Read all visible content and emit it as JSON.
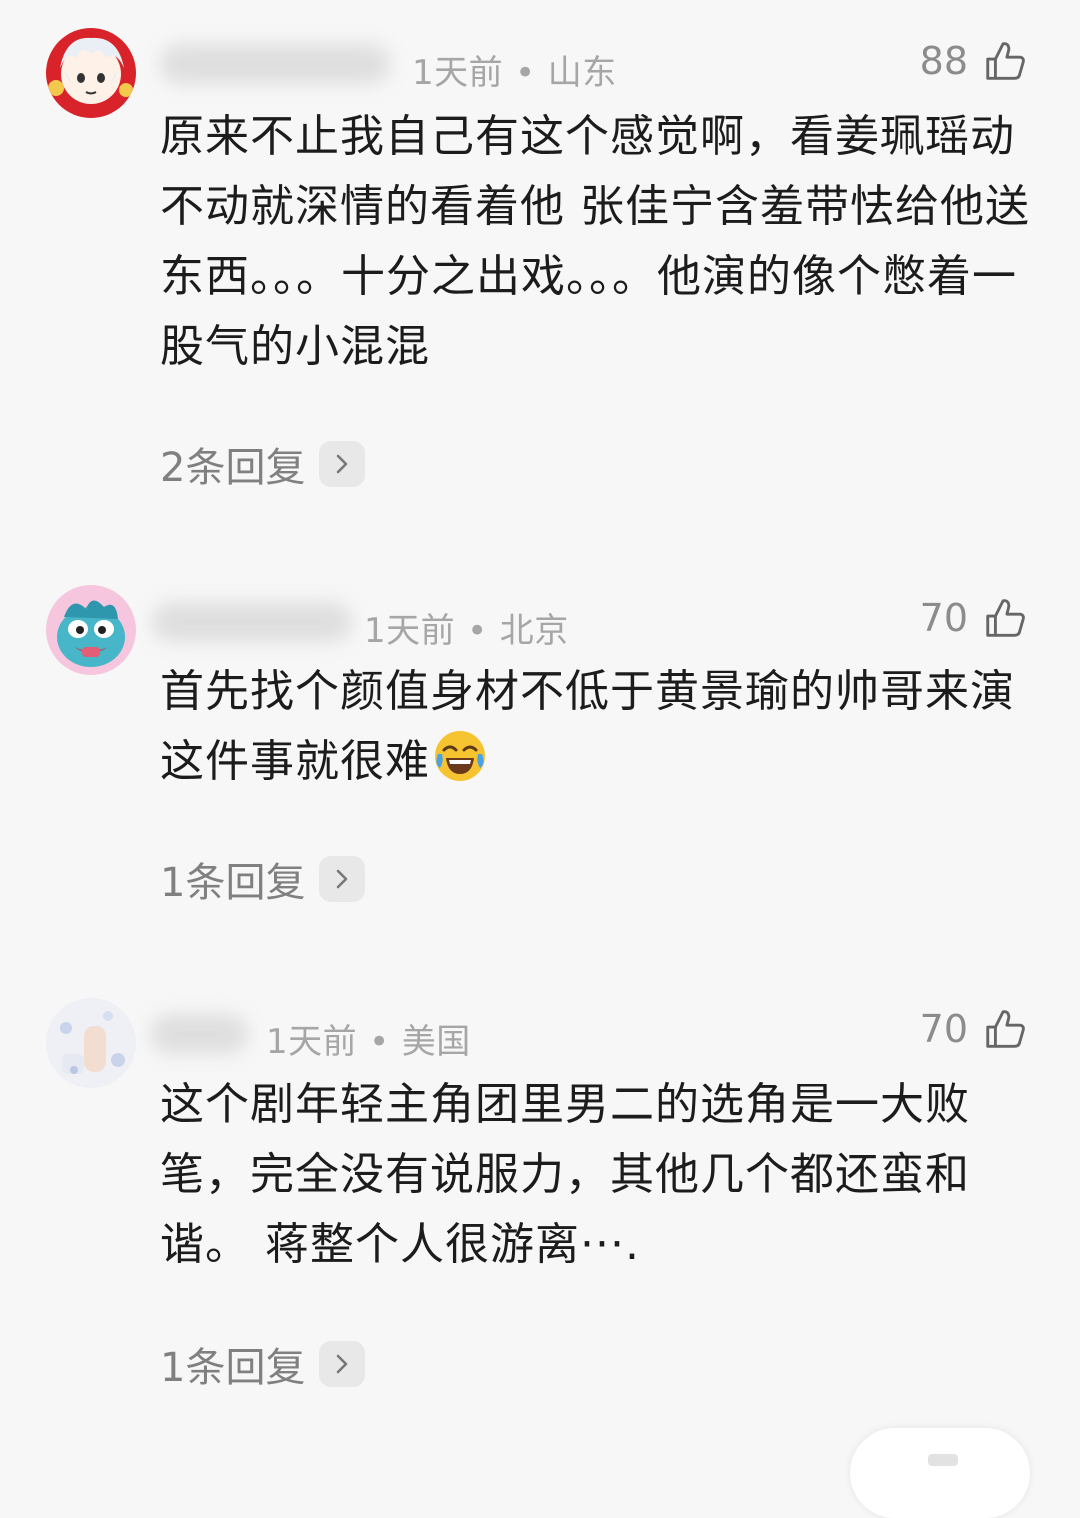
{
  "comments": [
    {
      "time": "1天前",
      "location": "山东",
      "likes": "88",
      "text": "原来不止我自己有这个感觉啊，看姜珮瑶动不动就深情的看着他 张佳宁含羞带怯给他送东西。。。十分之出戏。。。他演的像个憋着一股气的小混混",
      "replies": "2条回复",
      "emoji": ""
    },
    {
      "time": "1天前",
      "location": "北京",
      "likes": "70",
      "text": "首先找个颜值身材不低于黄景瑜的帅哥来演这件事就很难",
      "replies": "1条回复",
      "emoji": "laughing-tears-emoji"
    },
    {
      "time": "1天前",
      "location": "美国",
      "likes": "70",
      "text": "这个剧年轻主角团里男二的选角是一大败笔，完全没有说服力，其他几个都还蛮和谐。 蒋整个人很游离···.",
      "replies": "1条回复",
      "emoji": ""
    }
  ],
  "icons": {
    "like": "thumbs-up-icon",
    "reply_chevron": "chevron-right-icon",
    "meta_separator": "•"
  },
  "colors": {
    "background": "#f7f7f7",
    "text": "#1c1c1c",
    "meta": "#a6a6a6",
    "likes": "#8c8c8c",
    "replies": "#808080"
  }
}
